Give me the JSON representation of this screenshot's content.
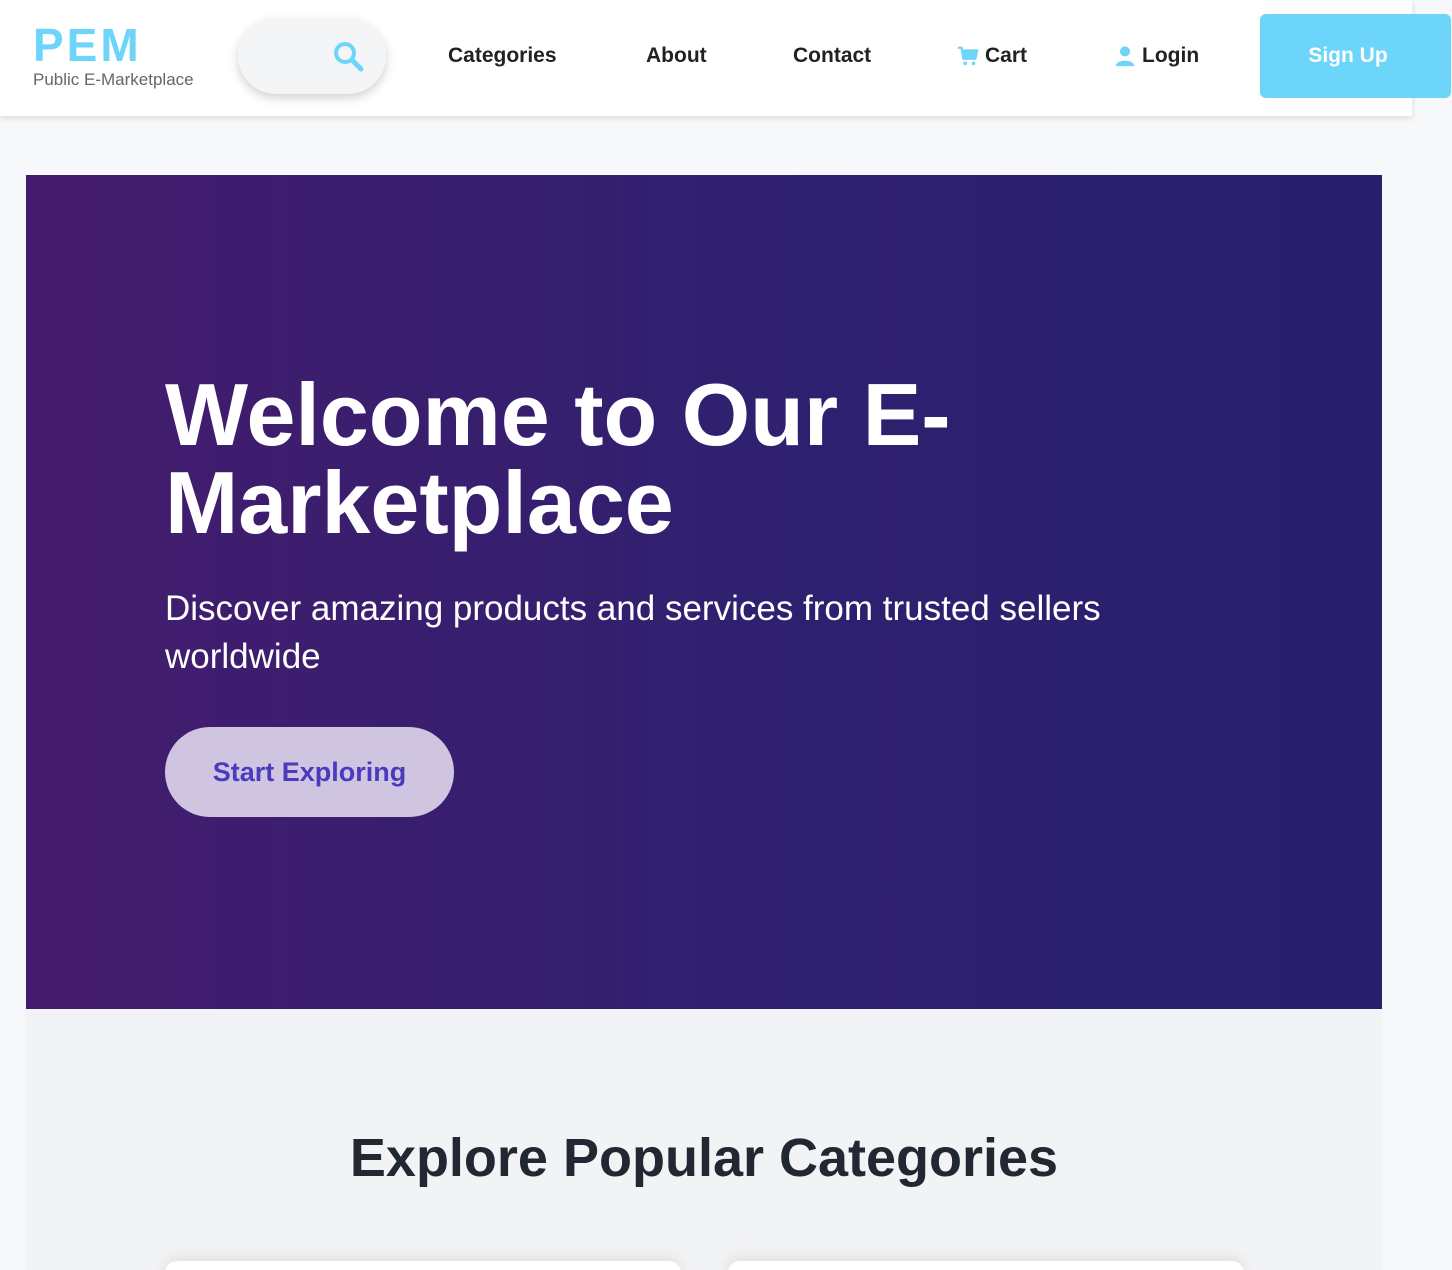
{
  "header": {
    "logo_title": "PEM",
    "logo_subtitle": "Public E-Marketplace",
    "search_icon": "search-icon",
    "nav": {
      "categories": "Categories",
      "about": "About",
      "contact": "Contact",
      "cart": "Cart",
      "login": "Login"
    },
    "signup_label": "Sign Up",
    "accent_color": "#6dd5fa"
  },
  "hero": {
    "title": "Welcome to Our E-Marketplace",
    "subtitle": "Discover amazing products and services from trusted sellers worldwide",
    "cta_label": "Start Exploring",
    "gradient_start": "#451c6d",
    "gradient_end": "#271f6c"
  },
  "categories": {
    "heading": "Explore Popular Categories"
  }
}
